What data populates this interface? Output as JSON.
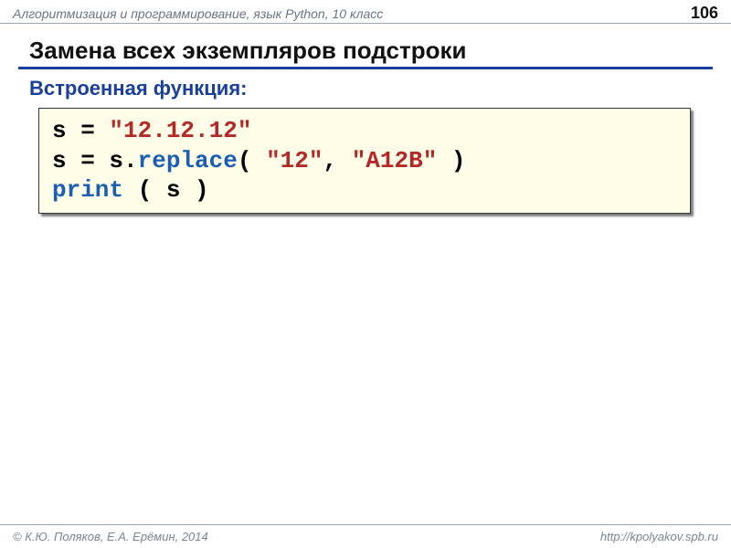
{
  "header": {
    "course": "Алгоритмизация и программирование, язык Python, 10 класс",
    "page_number": "106"
  },
  "title": "Замена всех экземпляров подстроки",
  "subtitle": "Встроенная функция:",
  "code": {
    "line1": {
      "p1": "s = ",
      "str1": "\"12.12.12\""
    },
    "line2": {
      "p1": "s = s.",
      "func": "replace",
      "p2": "( ",
      "str1": "\"12\"",
      "p3": ", ",
      "str2": "\"A12B\"",
      "p4": " )"
    },
    "line3": {
      "kw": "print",
      "p1": " ( s )"
    }
  },
  "footer": {
    "copyright": "© К.Ю. Поляков, Е.А. Ерёмин, 2014",
    "url": "http://kpolyakov.spb.ru"
  }
}
